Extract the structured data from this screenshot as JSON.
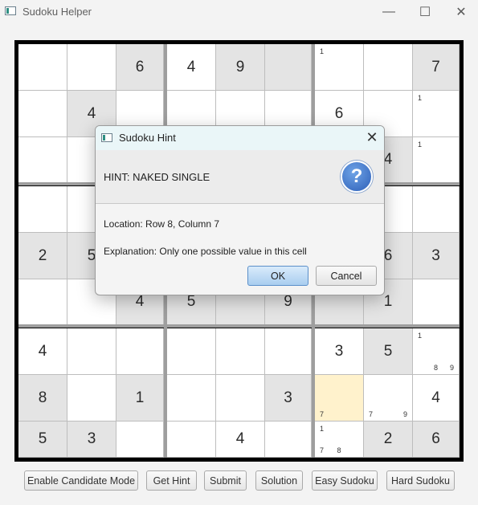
{
  "window": {
    "title": "Sudoku Helper",
    "minimize": "—",
    "maximize": "☐",
    "close": "✕"
  },
  "board": {
    "rows": [
      [
        {
          "v": ""
        },
        {
          "v": ""
        },
        {
          "v": "6",
          "given": true
        },
        {
          "v": "4"
        },
        {
          "v": "9",
          "given": true
        },
        {
          "v": "",
          "given": true
        },
        {
          "c": [
            "1"
          ]
        },
        {
          "v": ""
        },
        {
          "v": "7",
          "given": true
        }
      ],
      [
        {
          "v": ""
        },
        {
          "v": "4",
          "given": true
        },
        {
          "v": ""
        },
        {
          "v": ""
        },
        {
          "v": ""
        },
        {
          "v": ""
        },
        {
          "v": "6"
        },
        {
          "v": ""
        },
        {
          "c": [
            "1"
          ]
        }
      ],
      [
        {
          "v": ""
        },
        {
          "v": ""
        },
        {
          "v": ""
        },
        {
          "v": ""
        },
        {
          "v": ""
        },
        {
          "v": ""
        },
        {
          "v": ""
        },
        {
          "v": "4",
          "given": true
        },
        {
          "c": [
            "1"
          ]
        }
      ],
      [
        {
          "v": ""
        },
        {
          "v": ""
        },
        {
          "v": ""
        },
        {
          "v": ""
        },
        {
          "v": ""
        },
        {
          "v": ""
        },
        {
          "v": ""
        },
        {
          "v": ""
        },
        {
          "v": ""
        }
      ],
      [
        {
          "v": "2",
          "given": true
        },
        {
          "v": "5",
          "given": true
        },
        {
          "v": "",
          "given": true
        },
        {
          "v": "",
          "given": true
        },
        {
          "v": "",
          "given": true
        },
        {
          "v": "",
          "given": true
        },
        {
          "v": "",
          "given": true
        },
        {
          "v": "6",
          "given": true
        },
        {
          "v": "3",
          "given": true
        }
      ],
      [
        {
          "v": ""
        },
        {
          "v": ""
        },
        {
          "v": "4",
          "given": true
        },
        {
          "v": "5",
          "given": true
        },
        {
          "v": "",
          "given": true
        },
        {
          "v": "9",
          "given": true
        },
        {
          "v": "",
          "given": true
        },
        {
          "v": "1",
          "given": true
        },
        {
          "v": ""
        }
      ],
      [
        {
          "v": "4"
        },
        {
          "v": ""
        },
        {
          "v": ""
        },
        {
          "v": ""
        },
        {
          "v": ""
        },
        {
          "v": ""
        },
        {
          "v": "3"
        },
        {
          "v": "5",
          "given": true
        },
        {
          "c": [
            "1",
            "",
            "",
            "",
            "",
            "",
            "",
            "8",
            "9"
          ]
        }
      ],
      [
        {
          "v": "8",
          "given": true
        },
        {
          "v": ""
        },
        {
          "v": "1",
          "given": true
        },
        {
          "v": ""
        },
        {
          "v": ""
        },
        {
          "v": "3",
          "given": true
        },
        {
          "selected": true,
          "c": [
            "",
            "",
            "",
            "",
            "",
            "",
            "7",
            "",
            ""
          ]
        },
        {
          "c": [
            "",
            "",
            "",
            "",
            "",
            "",
            "7",
            "",
            "9"
          ]
        },
        {
          "v": "4"
        }
      ],
      [
        {
          "v": "5",
          "given": true
        },
        {
          "v": "3",
          "given": true
        },
        {
          "v": ""
        },
        {
          "v": ""
        },
        {
          "v": "4"
        },
        {
          "v": ""
        },
        {
          "c": [
            "1",
            "",
            "",
            "",
            "",
            "",
            "7",
            "8",
            ""
          ]
        },
        {
          "v": "2",
          "given": true
        },
        {
          "v": "6",
          "given": true
        }
      ]
    ]
  },
  "buttons": [
    {
      "label": "Enable Candidate Mode"
    },
    {
      "label": "Get Hint"
    },
    {
      "label": "Submit"
    },
    {
      "label": "Solution"
    },
    {
      "label": "Easy Sudoku"
    },
    {
      "label": "Hard Sudoku"
    }
  ],
  "dialog": {
    "title": "Sudoku Hint",
    "close": "✕",
    "hint": "HINT: NAKED SINGLE",
    "help_glyph": "?",
    "location": "Location: Row 8, Column 7",
    "explanation": "Explanation: Only one possible value in this cell",
    "ok": "OK",
    "cancel": "Cancel"
  }
}
